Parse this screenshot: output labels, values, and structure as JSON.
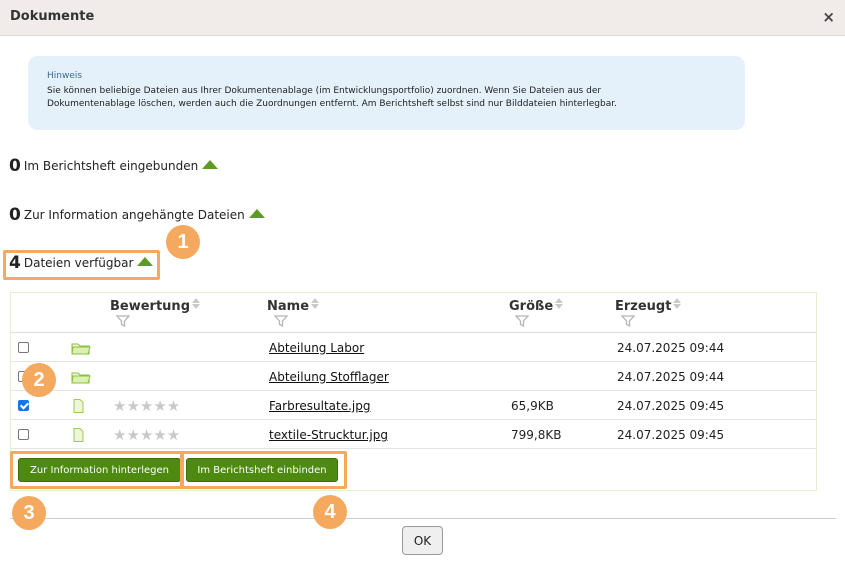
{
  "dialog": {
    "title": "Dokumente",
    "close_glyph": "×"
  },
  "hint": {
    "heading": "Hinweis",
    "text": "Sie können beliebige Dateien aus Ihrer Dokumentenablage (im Entwicklungsportfolio) zuordnen. Wenn Sie Dateien aus der Dokumentenablage löschen, werden auch die Zuordnungen entfernt. Am Berichtsheft selbst sind nur Bilddateien hinterlegbar."
  },
  "sections": [
    {
      "count": "0",
      "label": "Im Berichtsheft eingebunden"
    },
    {
      "count": "0",
      "label": "Zur Information angehängte Dateien"
    },
    {
      "count": "4",
      "label": "Dateien verfügbar"
    }
  ],
  "table": {
    "headers": {
      "rating": "Bewertung",
      "name": "Name",
      "size": "Größe",
      "created": "Erzeugt"
    },
    "rows": [
      {
        "checked": false,
        "icon": "folder-icon",
        "stars": "",
        "name": "Abteilung Labor",
        "size": "",
        "created": "24.07.2025 09:44"
      },
      {
        "checked": false,
        "icon": "folder-icon",
        "stars": "",
        "name": "Abteilung Stofflager",
        "size": "",
        "created": "24.07.2025 09:44"
      },
      {
        "checked": true,
        "icon": "file-icon",
        "stars": "★★★★★",
        "name": "Farbresultate.jpg",
        "size": "65,9KB",
        "created": "24.07.2025 09:45"
      },
      {
        "checked": false,
        "icon": "file-icon",
        "stars": "★★★★★",
        "name": "textile-Strucktur.jpg",
        "size": "799,8KB",
        "created": "24.07.2025 09:45"
      }
    ]
  },
  "buttons": {
    "attach_info": "Zur Information hinterlegen",
    "embed": "Im Berichtsheft einbinden",
    "ok": "OK"
  },
  "annotations": [
    "1",
    "2",
    "3",
    "4"
  ],
  "colors": {
    "accent_green": "#4d8a0f",
    "annotation_orange": "#f4a95e",
    "hint_bg": "#e4f1fb"
  }
}
